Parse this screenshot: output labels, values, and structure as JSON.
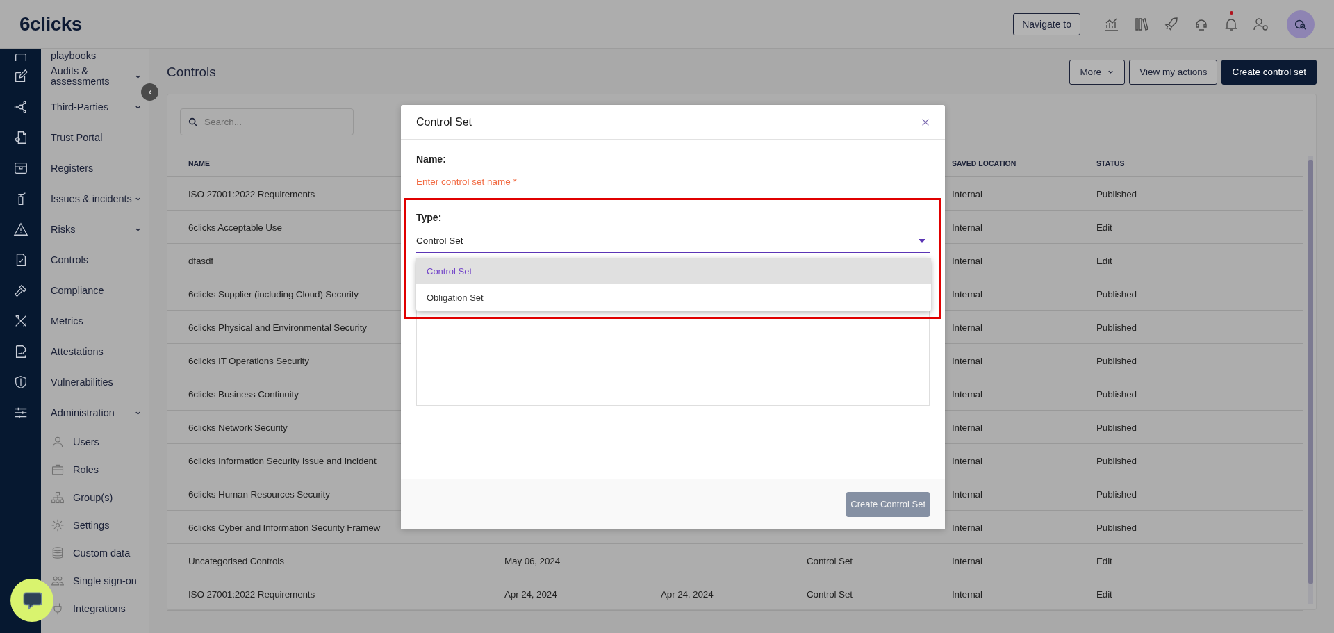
{
  "top_bar": {
    "logo": "6clicks",
    "navigate_button": "Navigate to",
    "notification_dot": true
  },
  "sidebar": {
    "items": [
      {
        "label": "playbooks",
        "kind": "link"
      },
      {
        "label": "Audits & assessments",
        "kind": "group"
      },
      {
        "label": "Third-Parties",
        "kind": "group"
      },
      {
        "label": "Trust Portal",
        "kind": "link"
      },
      {
        "label": "Registers",
        "kind": "link"
      },
      {
        "label": "Issues & incidents",
        "kind": "group"
      },
      {
        "label": "Risks",
        "kind": "group"
      },
      {
        "label": "Controls",
        "kind": "link"
      },
      {
        "label": "Compliance",
        "kind": "link"
      },
      {
        "label": "Metrics",
        "kind": "link"
      },
      {
        "label": "Attestations",
        "kind": "link"
      },
      {
        "label": "Vulnerabilities",
        "kind": "link"
      },
      {
        "label": "Administration",
        "kind": "group",
        "children": [
          {
            "label": "Users"
          },
          {
            "label": "Roles"
          },
          {
            "label": "Group(s)"
          },
          {
            "label": "Settings"
          },
          {
            "label": "Custom data"
          },
          {
            "label": "Single sign-on"
          },
          {
            "label": "Integrations"
          }
        ]
      }
    ]
  },
  "page": {
    "title": "Controls",
    "buttons": [
      {
        "label": "More",
        "kind": "menu"
      },
      {
        "label": "View my actions",
        "kind": "outline"
      },
      {
        "label": "Create control set",
        "kind": "primary"
      }
    ]
  },
  "search": {
    "placeholder": "Search..."
  },
  "table": {
    "headers": {
      "name": "NAME",
      "saved_location": "SAVED LOCATION",
      "status": "STATUS"
    },
    "rows": [
      {
        "name": "ISO 27001:2022 Requirements",
        "saved_location": "Internal",
        "status": "Published"
      },
      {
        "name": "6clicks Acceptable Use",
        "saved_location": "Internal",
        "status": "Edit"
      },
      {
        "name": "dfasdf",
        "saved_location": "Internal",
        "status": "Edit"
      },
      {
        "name": "6clicks Supplier (including Cloud) Security",
        "saved_location": "Internal",
        "status": "Published"
      },
      {
        "name": "6clicks Physical and Environmental Security",
        "saved_location": "Internal",
        "status": "Published"
      },
      {
        "name": "6clicks IT Operations Security",
        "saved_location": "Internal",
        "status": "Published"
      },
      {
        "name": "6clicks Business Continuity",
        "saved_location": "Internal",
        "status": "Published"
      },
      {
        "name": "6clicks Network Security",
        "saved_location": "Internal",
        "status": "Published"
      },
      {
        "name": "6clicks Information Security Issue and Incident",
        "saved_location": "Internal",
        "status": "Published"
      },
      {
        "name": "6clicks Human Resources Security",
        "saved_location": "Internal",
        "status": "Published"
      },
      {
        "name": "6clicks Cyber and Information Security Framew",
        "saved_location": "Internal",
        "status": "Published"
      },
      {
        "name": "Uncategorised Controls",
        "column_2": "May 06, 2024",
        "column_4": "Control Set",
        "saved_location": "Internal",
        "status": "Edit"
      },
      {
        "name": "ISO 27001:2022 Requirements",
        "column_2": "Apr 24, 2024",
        "column_3": "Apr 24, 2024",
        "column_4": "Control Set",
        "saved_location": "Internal",
        "status": "Edit"
      }
    ]
  },
  "modal": {
    "title": "Control Set",
    "name_label": "Name:",
    "name_field": {
      "placeholder": "Enter control set name *"
    },
    "type_label": "Type:",
    "type_select": {
      "value": "Control Set",
      "open": true,
      "options": [
        {
          "label": "Control Set",
          "selected": true
        },
        {
          "label": "Obligation Set",
          "selected": false
        }
      ]
    },
    "submit_button": {
      "label": "Create Control Set",
      "disabled": true
    }
  }
}
